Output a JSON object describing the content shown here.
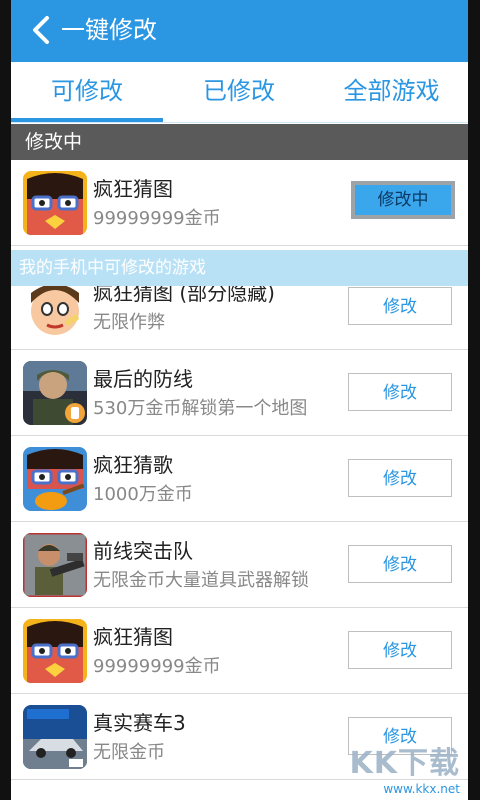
{
  "header": {
    "title": "一键修改"
  },
  "tabs": [
    {
      "label": "可修改"
    },
    {
      "label": "已修改"
    },
    {
      "label": "全部游戏"
    }
  ],
  "sections": {
    "in_progress": "修改中",
    "available": "我的手机中可修改的游戏"
  },
  "current": {
    "name": "疯狂猜图",
    "desc": "99999999金币",
    "button": "修改中"
  },
  "games": [
    {
      "name": "疯狂猜图 (部分隐藏)",
      "desc": "无限作弊",
      "button": "修改"
    },
    {
      "name": "最后的防线",
      "desc": "530万金币解锁第一个地图",
      "button": "修改"
    },
    {
      "name": "疯狂猜歌",
      "desc": "1000万金币",
      "button": "修改"
    },
    {
      "name": "前线突击队",
      "desc": "无限金币大量道具武器解锁",
      "button": "修改"
    },
    {
      "name": "疯狂猜图",
      "desc": "99999999金币",
      "button": "修改"
    },
    {
      "name": "真实赛车3",
      "desc": "无限金币",
      "button": "修改"
    }
  ],
  "watermark": {
    "logo": "KK下载",
    "url": "www.kkx.net"
  },
  "colors": {
    "accent": "#2b96e2",
    "section_dark": "#5a5a5a",
    "section_light": "#b9e1f6"
  }
}
